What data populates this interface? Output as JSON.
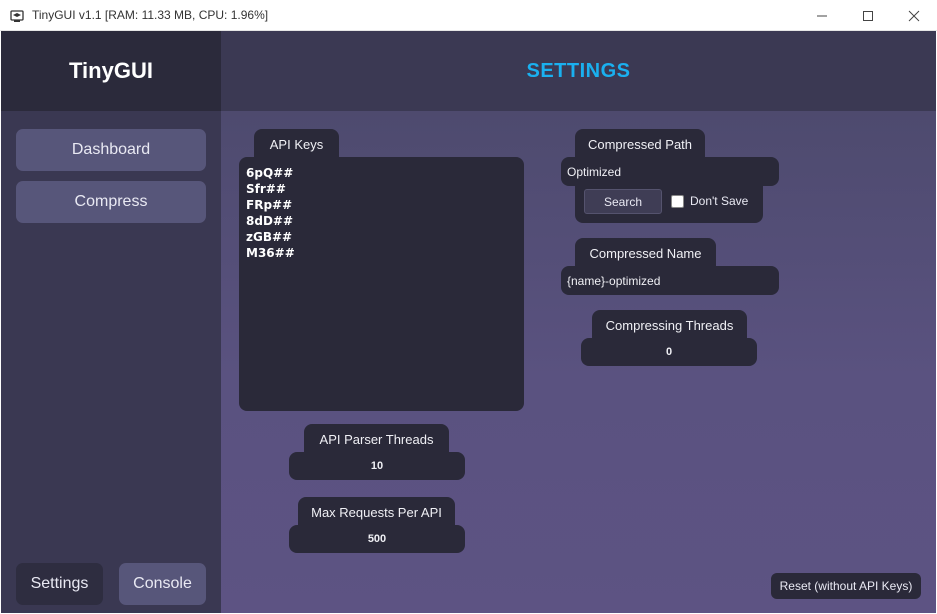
{
  "window": {
    "title": "TinyGUI v1.1 [RAM: 11.33 MB, CPU: 1.96%]"
  },
  "sidebar": {
    "logo": "TinyGUI",
    "items": [
      {
        "label": "Dashboard"
      },
      {
        "label": "Compress"
      }
    ],
    "bottom": [
      {
        "label": "Settings"
      },
      {
        "label": "Console"
      }
    ]
  },
  "header": {
    "title": "SETTINGS",
    "title_color": "#1ab0ef"
  },
  "settings": {
    "api_keys": {
      "label": "API Keys",
      "lines": [
        "6pQ##",
        "Sfr##",
        "FRp##",
        "8dD##",
        "zGB##",
        "M36##"
      ]
    },
    "api_parser_threads": {
      "label": "API Parser Threads",
      "value": "10"
    },
    "max_requests_per_api": {
      "label": "Max Requests Per API",
      "value": "500"
    },
    "compressed_path": {
      "label": "Compressed Path",
      "value": "Optimized",
      "search_label": "Search",
      "dont_save_label": "Don't Save",
      "dont_save_checked": false
    },
    "compressed_name": {
      "label": "Compressed Name",
      "value": "{name}-optimized"
    },
    "compressing_threads": {
      "label": "Compressing Threads",
      "value": "0"
    },
    "reset_label": "Reset (without API Keys)"
  }
}
